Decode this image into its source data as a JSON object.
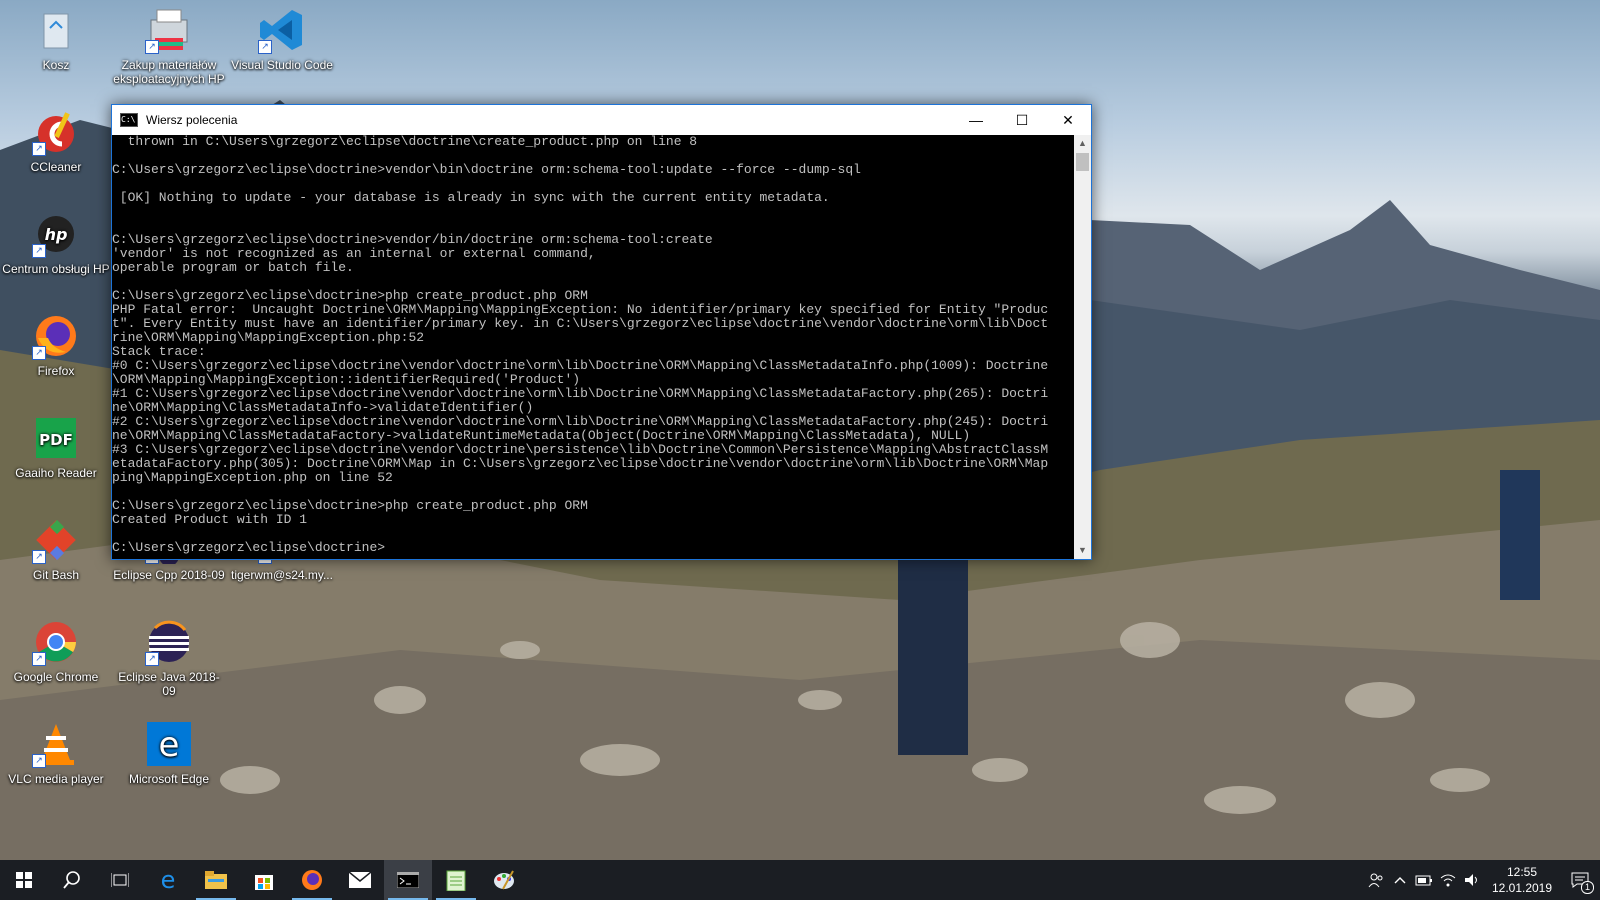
{
  "desktop": {
    "icons": [
      {
        "label": "Kosz"
      },
      {
        "label": "Zakup materiałów eksploatacyjnych HP"
      },
      {
        "label": "Visual Studio Code"
      },
      {
        "label": "CCleaner"
      },
      {
        "label": "Centrum obsługi HP"
      },
      {
        "label": "Firefox"
      },
      {
        "label": "Gaaiho Reader"
      },
      {
        "label": "Git Bash"
      },
      {
        "label": "Eclipse Cpp 2018-09"
      },
      {
        "label": "tigerwm@s24.my..."
      },
      {
        "label": "Google Chrome"
      },
      {
        "label": "Eclipse Java 2018-09"
      },
      {
        "label": "VLC media player"
      },
      {
        "label": "Microsoft Edge"
      }
    ]
  },
  "window": {
    "title": "Wiersz polecenia",
    "console_text": "  thrown in C:\\Users\\grzegorz\\eclipse\\doctrine\\create_product.php on line 8\n\nC:\\Users\\grzegorz\\eclipse\\doctrine>vendor\\bin\\doctrine orm:schema-tool:update --force --dump-sql\n\n [OK] Nothing to update - your database is already in sync with the current entity metadata.\n\n\nC:\\Users\\grzegorz\\eclipse\\doctrine>vendor/bin/doctrine orm:schema-tool:create\n'vendor' is not recognized as an internal or external command,\noperable program or batch file.\n\nC:\\Users\\grzegorz\\eclipse\\doctrine>php create_product.php ORM\nPHP Fatal error:  Uncaught Doctrine\\ORM\\Mapping\\MappingException: No identifier/primary key specified for Entity \"Produc\nt\". Every Entity must have an identifier/primary key. in C:\\Users\\grzegorz\\eclipse\\doctrine\\vendor\\doctrine\\orm\\lib\\Doct\nrine\\ORM\\Mapping\\MappingException.php:52\nStack trace:\n#0 C:\\Users\\grzegorz\\eclipse\\doctrine\\vendor\\doctrine\\orm\\lib\\Doctrine\\ORM\\Mapping\\ClassMetadataInfo.php(1009): Doctrine\n\\ORM\\Mapping\\MappingException::identifierRequired('Product')\n#1 C:\\Users\\grzegorz\\eclipse\\doctrine\\vendor\\doctrine\\orm\\lib\\Doctrine\\ORM\\Mapping\\ClassMetadataFactory.php(265): Doctri\nne\\ORM\\Mapping\\ClassMetadataInfo->validateIdentifier()\n#2 C:\\Users\\grzegorz\\eclipse\\doctrine\\vendor\\doctrine\\orm\\lib\\Doctrine\\ORM\\Mapping\\ClassMetadataFactory.php(245): Doctri\nne\\ORM\\Mapping\\ClassMetadataFactory->validateRuntimeMetadata(Object(Doctrine\\ORM\\Mapping\\ClassMetadata), NULL)\n#3 C:\\Users\\grzegorz\\eclipse\\doctrine\\vendor\\doctrine\\persistence\\lib\\Doctrine\\Common\\Persistence\\Mapping\\AbstractClassM\netadataFactory.php(305): Doctrine\\ORM\\Map in C:\\Users\\grzegorz\\eclipse\\doctrine\\vendor\\doctrine\\orm\\lib\\Doctrine\\ORM\\Map\nping\\MappingException.php on line 52\n\nC:\\Users\\grzegorz\\eclipse\\doctrine>php create_product.php ORM\nCreated Product with ID 1\n\nC:\\Users\\grzegorz\\eclipse\\doctrine>",
    "minimize_glyph": "—",
    "maximize_glyph": "☐",
    "close_glyph": "✕"
  },
  "taskbar": {
    "time": "12:55",
    "date": "12.01.2019",
    "notification_count": "1",
    "items": [
      {
        "icon": "start-icon"
      },
      {
        "icon": "search-icon"
      },
      {
        "icon": "task-view-icon"
      },
      {
        "icon": "edge-icon"
      },
      {
        "icon": "file-explorer-icon"
      },
      {
        "icon": "store-icon"
      },
      {
        "icon": "firefox-icon"
      },
      {
        "icon": "mail-icon"
      },
      {
        "icon": "command-prompt-icon"
      },
      {
        "icon": "notepad-icon"
      },
      {
        "icon": "paint-icon"
      }
    ]
  },
  "colors": {
    "accent": "#1c73d8",
    "console_bg": "#000000",
    "console_fg": "#c0c0c0",
    "taskbar_bg": "#1b1e23"
  }
}
